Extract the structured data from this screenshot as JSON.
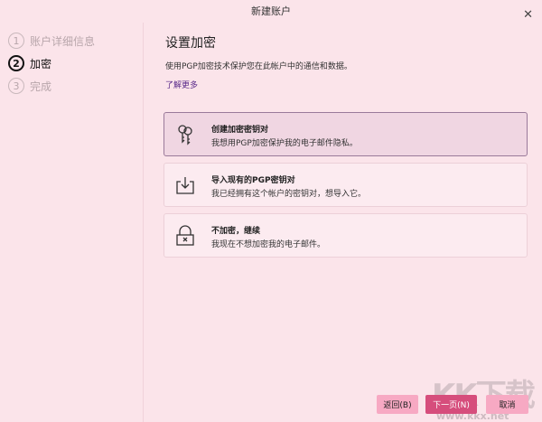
{
  "window": {
    "title": "新建账户",
    "close_icon": "close-icon"
  },
  "steps": [
    {
      "num": "1",
      "label": "账户详细信息",
      "state": "done"
    },
    {
      "num": "2",
      "label": "加密",
      "state": "active"
    },
    {
      "num": "3",
      "label": "完成",
      "state": "pending"
    }
  ],
  "main": {
    "heading": "设置加密",
    "description": "使用PGP加密技术保护您在此帐户中的通信和数据。",
    "learn_more": "了解更多",
    "options": [
      {
        "title": "创建加密密钥对",
        "subtitle": "我想用PGP加密保护我的电子邮件隐私。",
        "icon": "keys-icon",
        "selected": true
      },
      {
        "title": "导入现有的PGP密钥对",
        "subtitle": "我已经拥有这个帐户的密钥对，想导入它。",
        "icon": "import-icon",
        "selected": false
      },
      {
        "title": "不加密，继续",
        "subtitle": "我现在不想加密我的电子邮件。",
        "icon": "unlocked-icon",
        "selected": false
      }
    ]
  },
  "buttons": {
    "back": "返回(B)",
    "next": "下一页(N)",
    "cancel": "取消"
  },
  "colors": {
    "background": "#fbe4ea",
    "primary_button": "#d64d7c",
    "secondary_button": "#f7a9c3",
    "link": "#5a2a8a"
  },
  "watermark": {
    "logo": "KK下载",
    "url": "www.kkx.net"
  }
}
